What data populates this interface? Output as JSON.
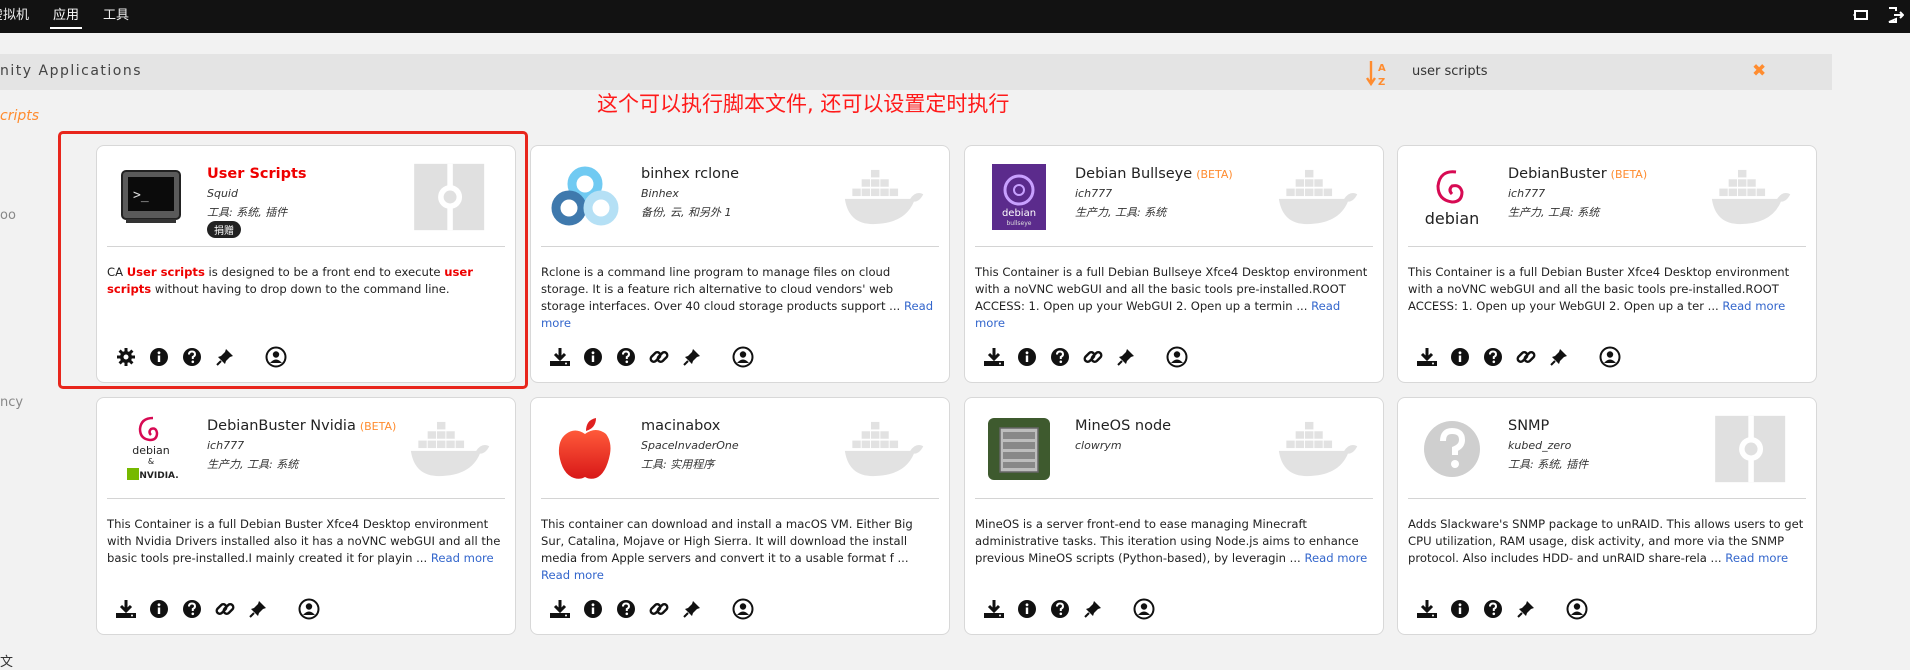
{
  "topnav": {
    "items": [
      "虚拟机",
      "应用",
      "工具"
    ]
  },
  "sidebar": {
    "fragments": [
      "nity Applications",
      "cripts",
      "oo",
      "ncy",
      "文"
    ]
  },
  "header": {
    "title": "nity Applications",
    "search_value": "user scripts",
    "sort_icon": "sort-az-icon",
    "clear_icon": "close-icon"
  },
  "annotation": "这个可以执行脚本文件, 还可以设置定时执行",
  "colors": {
    "accent": "#ff8c2f",
    "highlight": "#e8261c",
    "link": "#3366cc"
  },
  "cards": [
    {
      "name": "User Scripts",
      "beta": "",
      "author": "Squid",
      "categories": "工具: 系统, 插件",
      "donate": "捐赠",
      "desc_pre": "CA ",
      "desc_hl1": "User scripts",
      "desc_mid": " is designed to be a front end to execute ",
      "desc_hl2": "user scripts",
      "desc_post": " without having to drop down to the command line.",
      "read_more": ""
    },
    {
      "name": "binhex rclone",
      "beta": "",
      "author": "Binhex",
      "categories": "备份, 云, 和另外 1",
      "desc": "Rclone is a command line program to manage files on cloud storage. It is a feature rich alternative to cloud vendors' web storage interfaces. Over 40 cloud storage products support ...",
      "read_more": "Read more"
    },
    {
      "name": "Debian Bullseye",
      "beta": "(BETA)",
      "author": "ich777",
      "categories": "生产力, 工具: 系统",
      "desc": "This Container is a full Debian Bullseye Xfce4 Desktop environment with a noVNC webGUI and all the basic tools pre-installed.ROOT ACCESS: 1. Open up your WebGUI 2. Open up a termin ...",
      "read_more": "Read more"
    },
    {
      "name": "DebianBuster",
      "beta": "(BETA)",
      "author": "ich777",
      "categories": "生产力, 工具: 系统",
      "desc": "This Container is a full Debian Buster Xfce4 Desktop environment with a noVNC webGUI and all the basic tools pre-installed.ROOT ACCESS: 1. Open up your WebGUI 2. Open up a ter ...",
      "read_more": "Read more"
    },
    {
      "name": "DebianBuster Nvidia",
      "beta": "(BETA)",
      "author": "ich777",
      "categories": "生产力, 工具: 系统",
      "desc": "This Container is a full Debian Buster Xfce4 Desktop environment with Nvidia Drivers installed also it has a noVNC webGUI and all the basic tools pre-installed.I mainly created it for playin ...",
      "read_more": "Read more"
    },
    {
      "name": "macinabox",
      "beta": "",
      "author": "SpaceInvaderOne",
      "categories": "工具: 实用程序",
      "desc": "This container can download and install a macOS VM. Either Big Sur, Catalina, Mojave or High Sierra. It will download the install media from Apple servers and convert it to a usable format f ...",
      "read_more": "Read more"
    },
    {
      "name": "MineOS node",
      "beta": "",
      "author": "clowrym",
      "categories": "",
      "desc": "MineOS is a server front-end to ease managing Minecraft administrative tasks. This iteration using Node.js aims to enhance previous MineOS scripts (Python-based), by leveragin ...",
      "read_more": "Read more"
    },
    {
      "name": "SNMP",
      "beta": "",
      "author": "kubed_zero",
      "categories": "工具: 系统, 插件",
      "desc": "Adds Slackware's SNMP package to unRAID. This allows users to get CPU utilization, RAM usage, disk activity, and more via the SNMP protocol. Also includes HDD- and unRAID share-rela ...",
      "read_more": "Read more"
    }
  ]
}
